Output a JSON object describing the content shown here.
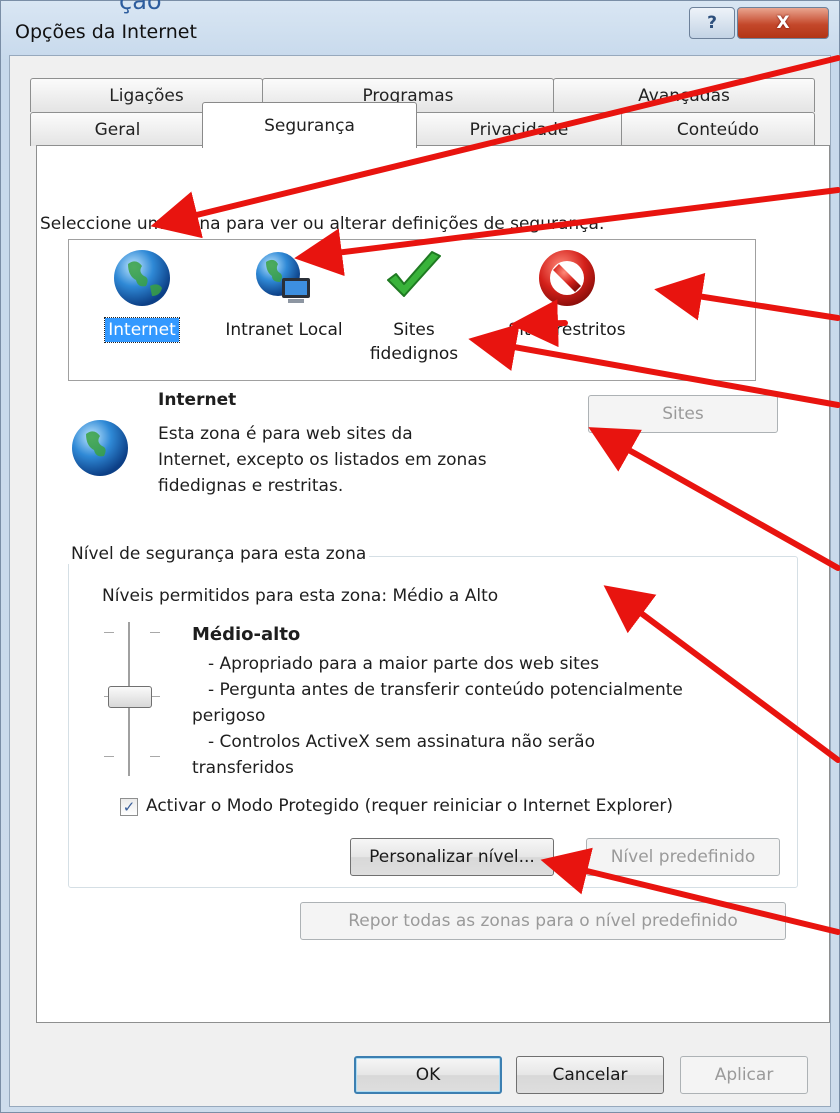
{
  "window": {
    "title": "Opções da Internet",
    "title_fragment": "ção",
    "help_glyph": "?",
    "close_glyph": "X"
  },
  "tabs": {
    "row_back": [
      "Ligações",
      "Programas",
      "Avançadas"
    ],
    "row_front": [
      "Geral",
      "Segurança",
      "Privacidade",
      "Conteúdo"
    ],
    "active": "Segurança"
  },
  "security": {
    "zone_prompt": "Seleccione uma zona para ver ou alterar definições de segurança.",
    "zones": [
      {
        "label": "Internet",
        "icon": "globe-icon",
        "selected": true
      },
      {
        "label": "Intranet Local",
        "icon": "intranet-globe-icon",
        "selected": false
      },
      {
        "label": "Sites fidedignos",
        "icon": "checkmark-icon",
        "selected": false
      },
      {
        "label": "Sites restritos",
        "icon": "no-entry-icon",
        "selected": false
      }
    ],
    "zone_title": "Internet",
    "zone_desc_lines": [
      "Esta zona é para web sites da",
      "Internet, excepto os listados em zonas",
      "fidedignas e restritas."
    ],
    "sites_button": "Sites",
    "level_group_title": "Nível de segurança para esta zona",
    "allowed_levels": "Níveis permitidos para esta zona: Médio a Alto",
    "level_name": "Médio-alto",
    "level_desc_lines": [
      "- Apropriado para a maior parte dos web sites",
      "- Pergunta antes de transferir conteúdo potencialmente",
      "perigoso",
      "- Controlos ActiveX sem assinatura não serão",
      "transferidos"
    ],
    "protected_mode_label": "Activar o Modo Protegido (requer reiniciar o Internet Explorer)",
    "protected_mode_checked": true,
    "custom_level_button": "Personalizar nível...",
    "default_level_button": "Nível predefinido",
    "reset_all_button": "Repor todas as zonas para o nível predefinido"
  },
  "footer": {
    "ok": "OK",
    "cancel": "Cancelar",
    "apply": "Aplicar"
  },
  "colors": {
    "annotation_arrow": "#e8140f",
    "selection": "#3399ff"
  }
}
